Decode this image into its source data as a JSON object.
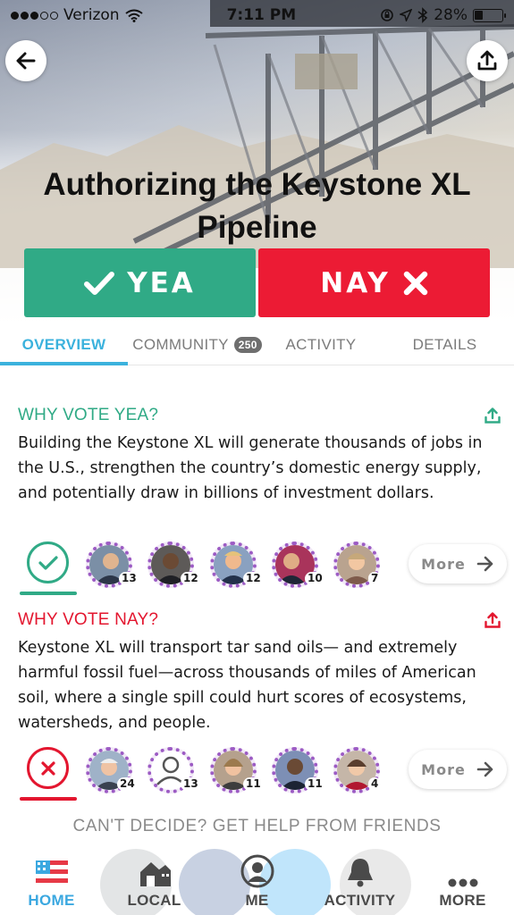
{
  "status_bar": {
    "carrier": "Verizon",
    "time": "7:11 PM",
    "battery": "28%",
    "battery_level": 0.28
  },
  "bill": {
    "title": "Authorizing the Keystone XL Pipeline"
  },
  "vote": {
    "yea_label": "YEA",
    "nay_label": "NAY",
    "yea_color": "#30aa86",
    "nay_color": "#ec1b34"
  },
  "tabs": [
    {
      "label": "OVERVIEW",
      "active": true
    },
    {
      "label": "COMMUNITY",
      "badge": "250"
    },
    {
      "label": "ACTIVITY"
    },
    {
      "label": "DETAILS"
    }
  ],
  "why_yea": {
    "title": "WHY VOTE YEA?",
    "body": "Building the Keystone XL will generate thousands of jobs in the U.S., strengthen the country’s domestic energy supply, and potentially draw in billions of investment dollars.",
    "supporter_counts": [
      "13",
      "12",
      "12",
      "10",
      "7"
    ],
    "more_label": "More"
  },
  "why_nay": {
    "title": "WHY VOTE NAY?",
    "body": "Keystone XL will transport tar sand oils— and extremely harmful fossil fuel—across thousands of miles of American soil, where a single spill could hurt scores of ecosystems, watersheds, and people.",
    "supporter_counts": [
      "24",
      "13",
      "11",
      "11",
      "4"
    ],
    "more_label": "More"
  },
  "help_prompt": "CAN'T DECIDE? GET HELP FROM FRIENDS",
  "bottom_nav": [
    {
      "label": "HOME",
      "icon": "flag-icon",
      "active": true
    },
    {
      "label": "LOCAL",
      "icon": "house-icon"
    },
    {
      "label": "ME",
      "icon": "person-icon"
    },
    {
      "label": "ACTIVITY",
      "icon": "bell-icon"
    },
    {
      "label": "MORE",
      "icon": "more-icon"
    }
  ],
  "colors": {
    "accent": "#3bb2dd",
    "yea": "#30aa86",
    "nay": "#e3162f",
    "avatar_ring": "#9c5bc4"
  }
}
